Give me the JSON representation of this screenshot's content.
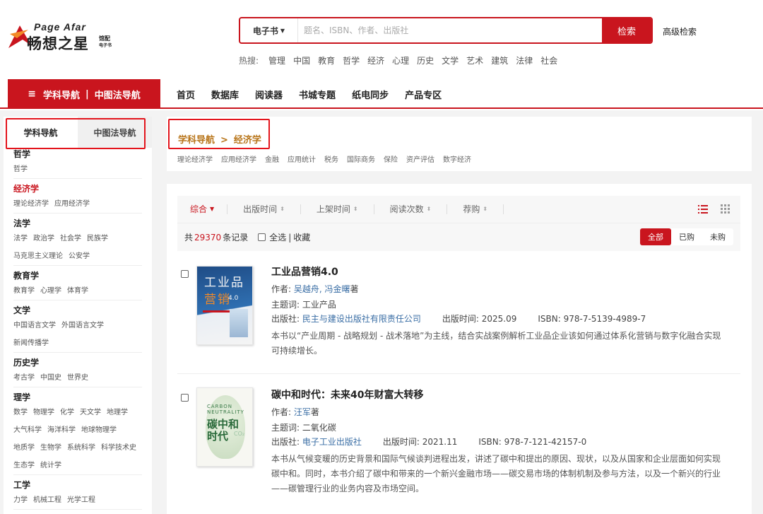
{
  "header": {
    "logo_en": "Page Afar",
    "logo_cn": "畅想之星",
    "logo_suffix_1": "馆配",
    "logo_suffix_2": "电子书",
    "search_type": "电子书",
    "search_placeholder": "题名、ISBN、作者、出版社",
    "search_button": "检索",
    "advanced_search": "高级检索",
    "hot_label": "热搜:",
    "hot_terms": [
      "管理",
      "中国",
      "教育",
      "哲学",
      "经济",
      "心理",
      "历史",
      "文学",
      "艺术",
      "建筑",
      "法律",
      "社会"
    ]
  },
  "nav": {
    "category_tab_1": "学科导航",
    "category_sep": "|",
    "category_tab_2": "中图法导航",
    "links": [
      "首页",
      "数据库",
      "阅读器",
      "书城专题",
      "纸电同步",
      "产品专区"
    ]
  },
  "sidebar": {
    "tabs": [
      "学科导航",
      "中图法导航"
    ],
    "groups": [
      {
        "title": "哲学",
        "items": [
          "哲学"
        ]
      },
      {
        "title": "经济学",
        "items": [
          "理论经济学",
          "应用经济学"
        ],
        "active": true
      },
      {
        "title": "法学",
        "items": [
          "法学",
          "政治学",
          "社会学",
          "民族学",
          "马克思主义理论",
          "公安学"
        ]
      },
      {
        "title": "教育学",
        "items": [
          "教育学",
          "心理学",
          "体育学"
        ]
      },
      {
        "title": "文学",
        "items": [
          "中国语言文学",
          "外国语言文学",
          "新闻传播学"
        ]
      },
      {
        "title": "历史学",
        "items": [
          "考古学",
          "中国史",
          "世界史"
        ]
      },
      {
        "title": "理学",
        "items": [
          "数学",
          "物理学",
          "化学",
          "天文学",
          "地理学",
          "大气科学",
          "海洋科学",
          "地球物理学",
          "地质学",
          "生物学",
          "系统科学",
          "科学技术史",
          "生态学",
          "统计学"
        ]
      },
      {
        "title": "工学",
        "items": [
          "力学",
          "机械工程",
          "光学工程"
        ]
      }
    ]
  },
  "breadcrumb": {
    "root": "学科导航",
    "sep": ">",
    "current": "经济学",
    "subcategories": [
      "理论经济学",
      "应用经济学",
      "金融",
      "应用统计",
      "税务",
      "国际商务",
      "保险",
      "资产评估",
      "数字经济"
    ]
  },
  "sort": {
    "items": [
      {
        "label": "综合",
        "arrow": "🠗",
        "active": true
      },
      {
        "label": "出版时间",
        "arrow": "⬍"
      },
      {
        "label": "上架时间",
        "arrow": "⬍"
      },
      {
        "label": "阅读次数",
        "arrow": "⬍"
      },
      {
        "label": "荐购",
        "arrow": "⬍"
      }
    ]
  },
  "count": {
    "prefix": "共",
    "number": "29370",
    "suffix": "条记录",
    "select_all": "全选",
    "sep": "|",
    "favorite": "收藏",
    "filters": [
      "全部",
      "已购",
      "未购"
    ]
  },
  "books": [
    {
      "title": "工业品营销4.0",
      "author_label": "作者:",
      "authors": "吴越舟, 冯金曙",
      "author_suffix": "著",
      "subject_label": "主题词:",
      "subject": "工业产品",
      "publisher_label": "出版社:",
      "publisher": "民主与建设出版社有限责任公司",
      "date_label": "出版时间:",
      "date": "2025.09",
      "isbn_label": "ISBN:",
      "isbn": "978-7-5139-4989-7",
      "description": "本书以“产业周期 - 战略规划 - 战术落地”为主线，结合实战案例解析工业品企业该如何通过体系化营销与数字化融合实现可持续增长。",
      "cover_line1": "工业品",
      "cover_line2": "营销",
      "cover_version": "4.0"
    },
    {
      "title": "碳中和时代：未来40年财富大转移",
      "author_label": "作者:",
      "authors": "汪军",
      "author_suffix": "著",
      "subject_label": "主题词:",
      "subject": "二氧化碳",
      "publisher_label": "出版社:",
      "publisher": "电子工业出版社",
      "date_label": "出版时间:",
      "date": "2021.11",
      "isbn_label": "ISBN:",
      "isbn": "978-7-121-42157-0",
      "description": "本书从气候变暖的历史背景和国际气候谈判进程出发，讲述了碳中和提出的原因、现状，以及从国家和企业层面如何实现碳中和。同时，本书介绍了碳中和带来的一个新兴金融市场——碳交易市场的体制机制及参与方法，以及一个新兴的行业——碳管理行业的业务内容及市场空间。",
      "cover_en1": "CARBON",
      "cover_en2": "NEUTRALITY",
      "cover_cn1": "碳中和",
      "cover_cn2": "时代",
      "cover_co2": "CO₂"
    }
  ],
  "colors": {
    "brand_red": "#c9151e",
    "breadcrumb_gold": "#b8751a",
    "link_blue": "#3a6ea5",
    "highlight_border": "#e3141c"
  }
}
